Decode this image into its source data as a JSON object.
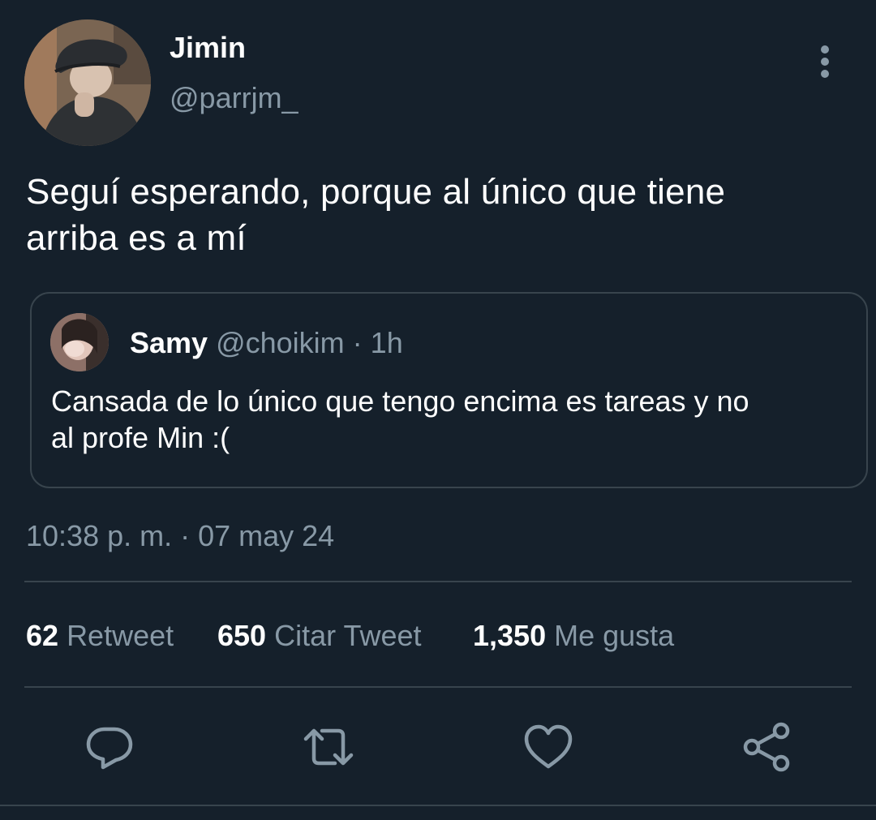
{
  "author": {
    "display_name": "Jimin",
    "handle": "@parrjm_"
  },
  "tweet": {
    "text_line1": "Seguí esperando, porque al único que tiene",
    "text_line2": "arriba es a mí",
    "timestamp": "10:38 p. m. · 07 may 24"
  },
  "quoted_tweet": {
    "display_name": "Samy",
    "handle": "@choikim",
    "separator": " · ",
    "age": "1h",
    "text_line1": "Cansada de lo único que tengo encima es tareas y no",
    "text_line2": "al profe Min :("
  },
  "stats": {
    "retweets": {
      "count": "62",
      "label": "Retweet"
    },
    "quotes": {
      "count": "650",
      "label": "Citar Tweet"
    },
    "likes": {
      "count": "1,350",
      "label": "Me gusta"
    }
  },
  "icons": {
    "more": "vertical-ellipsis-icon",
    "reply": "reply-icon",
    "retweet": "retweet-icon",
    "like": "heart-icon",
    "share": "share-icon"
  },
  "colors": {
    "background": "#15202b",
    "primary_text": "#ffffff",
    "secondary_text": "#8899a6",
    "border": "#38444d"
  }
}
